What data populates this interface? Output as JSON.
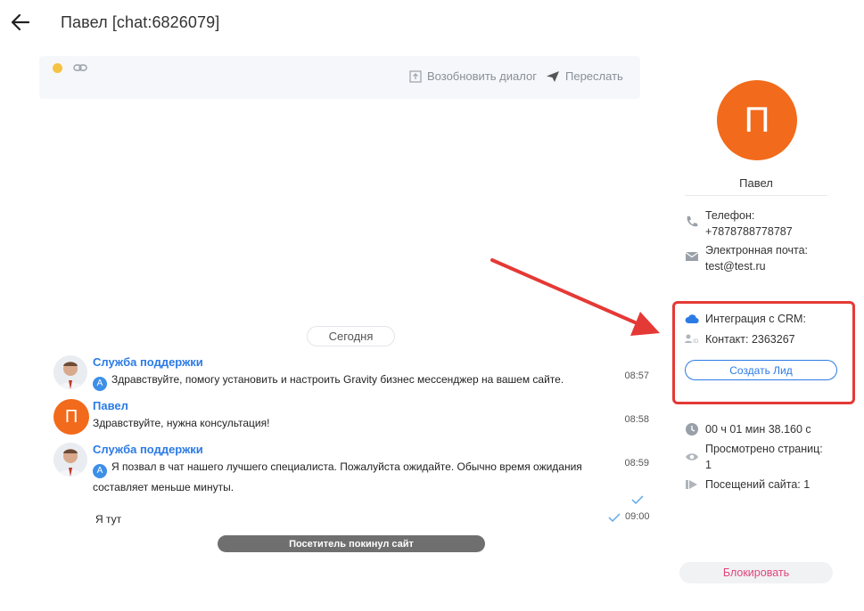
{
  "header": {
    "title": "Павел [chat:6826079]"
  },
  "toolbar": {
    "resume_label": "Возобновить диалог",
    "forward_label": "Переслать"
  },
  "chat": {
    "date_label": "Сегодня",
    "messages": [
      {
        "author": "Служба поддержки",
        "badge": "А",
        "text": "Здравствуйте, помогу установить и настроить Gravity бизнес мессенджер на вашем сайте.",
        "time": "08:57"
      },
      {
        "author": "Павел",
        "avatar_letter": "П",
        "text": "Здравствуйте, нужна консультация!",
        "time": "08:58"
      },
      {
        "author": "Служба поддержки",
        "badge": "А",
        "text": "Я позвал в чат нашего лучшего специалиста. Пожалуйста ожидайте. Обычно время ожидания составляет меньше минуты.",
        "time": "08:59"
      },
      {
        "text": "Я тут",
        "time": "09:00"
      }
    ],
    "visitor_left": "Посетитель покинул сайт"
  },
  "profile": {
    "avatar_letter": "П",
    "name": "Павел",
    "phone_label": "Телефон:",
    "phone": "+7878788778787",
    "email_label": "Электронная почта:",
    "email": "test@test.ru",
    "crm_label": "Интеграция с CRM:",
    "contact_label": "Контакт: 2363267",
    "create_lead": "Создать Лид",
    "duration": "00 ч 01 мин 38.160 с",
    "pages_viewed": "Просмотрено страниц: 1",
    "visits": "Посещений сайта: 1",
    "block": "Блокировать"
  },
  "colors": {
    "accent": "#2c7be5",
    "avatar": "#f26a1b",
    "annotation": "#e53935",
    "block": "#e0457b",
    "status_dot": "#f5c242"
  },
  "icons": [
    "back-arrow-icon",
    "status-dot-icon",
    "link-icon",
    "resume-icon",
    "send-icon",
    "phone-icon",
    "mail-icon",
    "cloud-icon",
    "id-icon",
    "clock-icon",
    "eye-icon",
    "visits-icon",
    "check-icon"
  ]
}
